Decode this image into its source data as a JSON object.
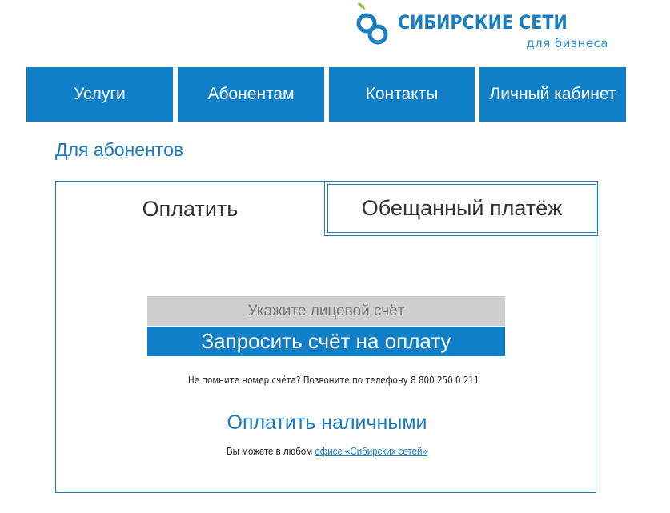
{
  "brand": {
    "name": "СИБИРСКИЕ СЕТИ",
    "tagline": "для бизнеса",
    "logo_icon": "sibirskie-seti-logo-icon",
    "colors": {
      "primary": "#0f7fc7",
      "accent_green": "#8cc63f",
      "input_gray": "#cfcfcf"
    }
  },
  "nav": {
    "items": [
      {
        "label": "Услуги"
      },
      {
        "label": "Абонентам"
      },
      {
        "label": "Контакты"
      },
      {
        "label": "Личный кабинет"
      }
    ]
  },
  "section": {
    "title": "Для абонентов"
  },
  "tabs": [
    {
      "label": "Оплатить",
      "active": true
    },
    {
      "label": "Обещанный платёж",
      "active": false
    }
  ],
  "payment_form": {
    "account_input": {
      "placeholder": "Укажите лицевой счёт",
      "value": ""
    },
    "request_button_label": "Запросить счёт на оплату",
    "hint": "Не помните номер счёта? Позвоните по телефону 8 800 250 0 211"
  },
  "cash": {
    "title": "Оплатить наличными",
    "text_prefix": "Вы можете в любом ",
    "link_text": "офисе «Сибирских сетей»"
  }
}
